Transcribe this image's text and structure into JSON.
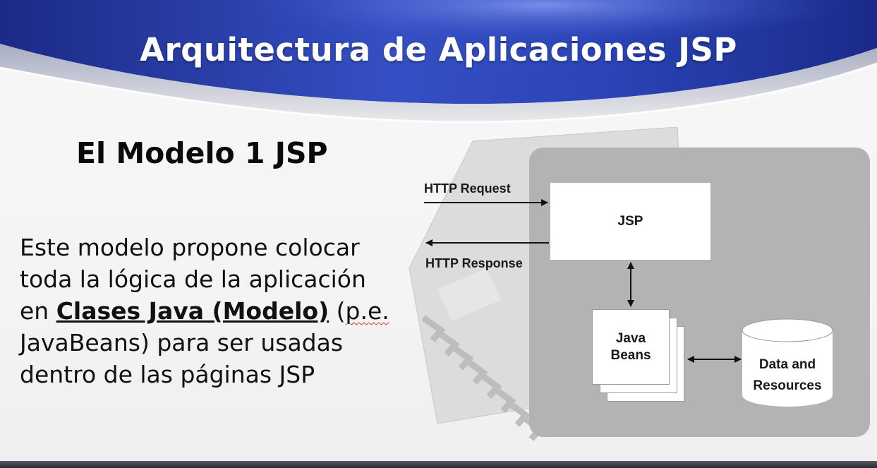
{
  "slide": {
    "title": "Arquitectura de Aplicaciones JSP",
    "subtitle": "El Modelo 1 JSP",
    "body": {
      "line1": "Este modelo propone colocar",
      "line2": "toda la lógica de la aplicación",
      "line3_prefix": "en ",
      "line3_emphasis": "Clases Java (Modelo)",
      "line3_space": " (",
      "line3_abbrev": "p.e.",
      "line4": "JavaBeans) para ser usadas",
      "line5": "dentro de las páginas JSP"
    }
  },
  "diagram": {
    "request_label": "HTTP Request",
    "response_label": "HTTP Response",
    "jsp_label": "JSP",
    "beans_label": "Java Beans",
    "data_label_line1": "Data and",
    "data_label_line2": "Resources"
  },
  "colors": {
    "banner_dark": "#1f2f8f",
    "banner_light": "#4a68d8",
    "diagram_bg": "#b3b3b3",
    "text_dark": "#111111"
  }
}
